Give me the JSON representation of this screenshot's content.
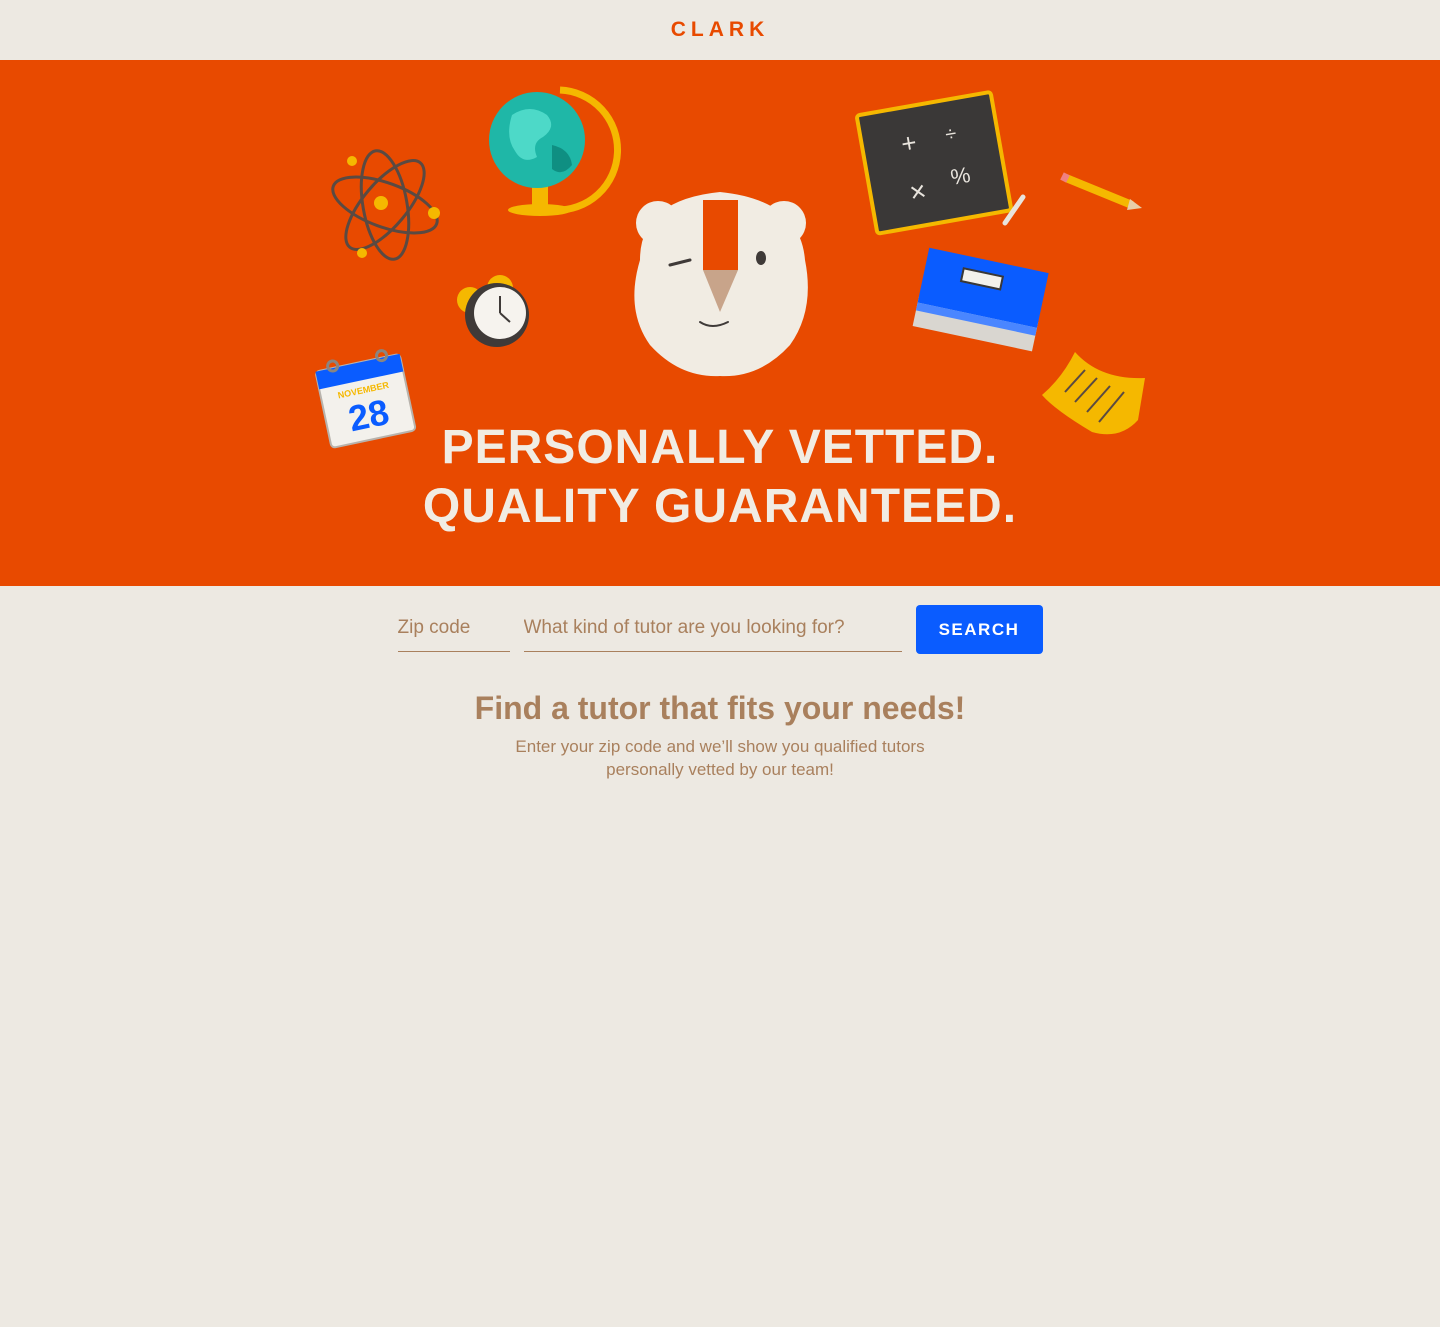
{
  "header": {
    "logo": "CLARK"
  },
  "hero": {
    "headline_line1": "PERSONALLY VETTED.",
    "headline_line2": "QUALITY GUARANTEED.",
    "calendar_month": "NOVEMBER",
    "calendar_day": "28",
    "illustrations": [
      "atom-icon",
      "globe-icon",
      "alarm-clock-icon",
      "calendar-icon",
      "mascot-icon",
      "chalkboard-icon",
      "pencil-icon",
      "book-icon",
      "paper-note-icon"
    ]
  },
  "search": {
    "zip_placeholder": "Zip code",
    "kind_placeholder": "What kind of tutor are you looking for?",
    "button_label": "SEARCH"
  },
  "info": {
    "heading": "Find a tutor that fits your needs!",
    "description": "Enter your zip code and we’ll show you qualified tutors personally vetted by our team!"
  },
  "colors": {
    "brand_orange": "#e84a00",
    "background": "#ede9e2",
    "accent_blue": "#0a5cff",
    "text_brown": "#a9805d",
    "hero_text": "#f1ece3"
  }
}
